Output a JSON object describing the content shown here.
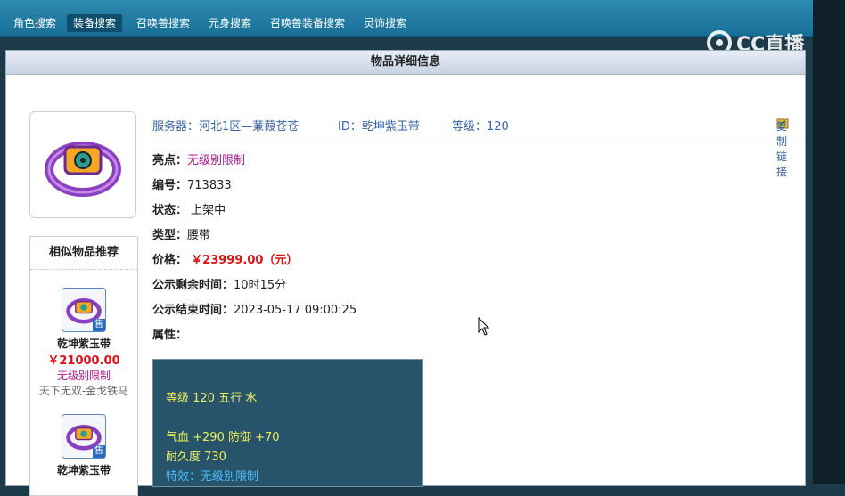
{
  "nav": {
    "tabs": [
      "角色搜索",
      "装备搜索",
      "召唤兽搜索",
      "元身搜索",
      "召唤兽装备搜索",
      "灵饰搜索"
    ],
    "active": "装备搜索"
  },
  "watermark": "CC直播",
  "panel": {
    "title": "物品详细信息"
  },
  "item_header": {
    "server": "服务器：河北1区—蒹葭苍苍",
    "id": "ID：乾坤紫玉带",
    "level": "等级：120",
    "copy": "复制链接"
  },
  "details": {
    "highlight_label": "亮点：",
    "highlight_value": "无级别限制",
    "number_label": "编号：",
    "number_value": "713833",
    "status_label": "状态：",
    "status_value": "上架中",
    "type_label": "类型：",
    "type_value": "腰带",
    "price_label": "价格：",
    "price_value": "￥23999.00（元）",
    "remain_label": "公示剩余时间：",
    "remain_value": "10时15分",
    "end_label": "公示结束时间：",
    "end_value": "2023-05-17 09:00:25",
    "attr_label": "属性："
  },
  "attributes": {
    "line1": "等级 120 五行 水",
    "line2": "气血 +290 防御 +70",
    "line3": "耐久度 730",
    "line4": "特效：无级别限制"
  },
  "similar": {
    "title": "相似物品推荐",
    "badge": "售",
    "items": [
      {
        "name": "乾坤紫玉带",
        "price": "￥21000.00",
        "tag": "无级别限制",
        "sub": "天下无双-金戈铁马"
      },
      {
        "name": "乾坤紫玉带"
      }
    ]
  }
}
